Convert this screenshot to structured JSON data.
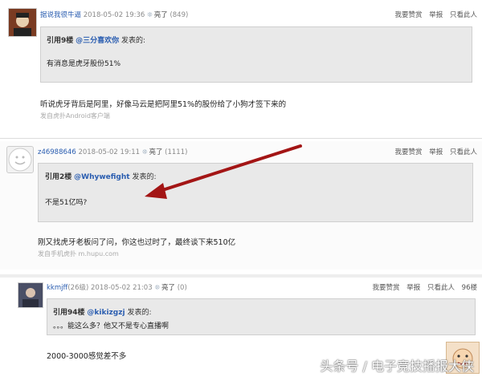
{
  "posts": [
    {
      "user": "据说我很牛逼",
      "date": "2018-05-02 19:36",
      "lit_label": "亮了",
      "lit_count": "(849)",
      "actions": [
        "我要赞赏",
        "举报",
        "只看此人"
      ],
      "quote": {
        "floor": "引用9楼",
        "user": "@三分喜欢你",
        "suffix": "发表的:",
        "text": "有消息是虎牙股份51%"
      },
      "reply": "听说虎牙背后是阿里，好像马云是把阿里51%的股份给了小狗才签下来的",
      "source": "发自虎扑Android客户端"
    },
    {
      "user": "z46988646",
      "date": "2018-05-02 19:11",
      "lit_label": "亮了",
      "lit_count": "(1111)",
      "actions": [
        "我要赞赏",
        "举报",
        "只看此人"
      ],
      "quote": {
        "floor": "引用2楼",
        "user": "@Whywefight",
        "suffix": "发表的:",
        "text": "不是51亿吗?"
      },
      "reply": "刚又找虎牙老板问了问，你这也过时了，最终谈下来510亿",
      "source": "发自手机虎扑 m.hupu.com"
    },
    {
      "user": "kkmjff",
      "level": "(26级)",
      "date": "2018-05-02 21:03",
      "lit_label": "亮了",
      "lit_count": "(0)",
      "actions": [
        "我要赞赏",
        "举报",
        "只看此人"
      ],
      "floor_num": "96楼",
      "quote": {
        "floor": "引用94楼",
        "user": "@kikizgzj",
        "suffix": "发表的:",
        "text": "。。。能这么多？他又不是专心直播啊"
      },
      "reply": "2000-3000感觉差不多"
    }
  ],
  "watermark": "头条号 / 电子竞技播报大侠",
  "colors": {
    "link": "#2a5db0",
    "quote_bg": "#e9e9e9",
    "arrow": "#a31515"
  }
}
